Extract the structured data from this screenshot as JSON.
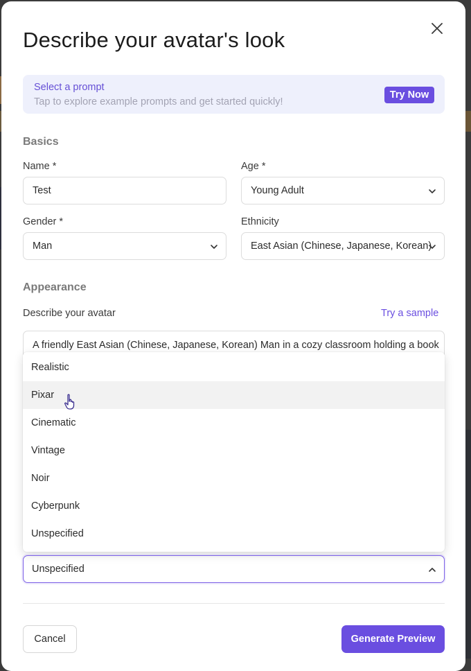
{
  "dialog": {
    "title": "Describe your avatar's look"
  },
  "prompt_banner": {
    "title": "Select a prompt",
    "subtitle": "Tap to explore example prompts and get started quickly!",
    "button_label": "Try Now"
  },
  "basics": {
    "heading": "Basics",
    "name_label": "Name *",
    "name_value": "Test",
    "age_label": "Age *",
    "age_value": "Young Adult",
    "gender_label": "Gender *",
    "gender_value": "Man",
    "ethnicity_label": "Ethnicity",
    "ethnicity_value": "East Asian (Chinese, Japanese, Korean)"
  },
  "appearance": {
    "heading": "Appearance",
    "describe_label": "Describe your avatar",
    "try_sample_label": "Try a sample",
    "description_value": "A friendly East Asian (Chinese, Japanese, Korean) Man in a cozy classroom holding a book"
  },
  "style_dropdown": {
    "options": [
      "Realistic",
      "Pixar",
      "Cinematic",
      "Vintage",
      "Noir",
      "Cyberpunk",
      "Unspecified"
    ],
    "hovered": "Pixar",
    "selected_value": "Unspecified"
  },
  "footer": {
    "cancel_label": "Cancel",
    "generate_label": "Generate Preview"
  },
  "colors": {
    "accent": "#6a4ee0",
    "banner_bg": "#eef0fc",
    "hover_bg": "#f2f2f2"
  },
  "icons": {
    "close": "close-icon",
    "chevron_down": "chevron-down-icon",
    "chevron_up": "chevron-up-icon",
    "cursor": "hand-pointer-icon"
  }
}
